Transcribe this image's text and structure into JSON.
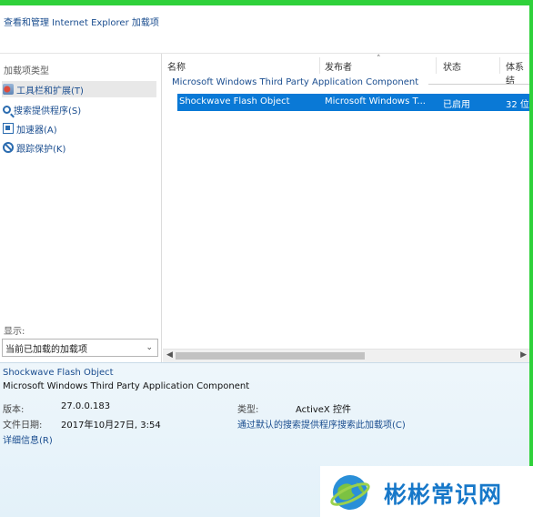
{
  "header": {
    "title": "查看和管理 Internet Explorer 加载项"
  },
  "left_panel": {
    "title": "加载项类型",
    "categories": [
      {
        "label": "工具栏和扩展(T)",
        "icon": "toolbar-extension-icon",
        "selected": true
      },
      {
        "label": "搜索提供程序(S)",
        "icon": "search-icon",
        "selected": false
      },
      {
        "label": "加速器(A)",
        "icon": "accelerator-icon",
        "selected": false
      },
      {
        "label": "跟踪保护(K)",
        "icon": "tracking-protection-icon",
        "selected": false
      }
    ],
    "show_label": "显示:",
    "show_select_value": "当前已加载的加载项"
  },
  "list": {
    "columns": [
      "名称",
      "发布者",
      "状态",
      "体系结"
    ],
    "group": "Microsoft Windows Third Party Application Component",
    "rows": [
      {
        "name": "Shockwave Flash Object",
        "publisher": "Microsoft Windows T...",
        "status": "已启用",
        "arch": "32 位"
      }
    ]
  },
  "details": {
    "name": "Shockwave Flash Object",
    "publisher": "Microsoft Windows Third Party Application Component",
    "version_label": "版本:",
    "version_value": "27.0.0.183",
    "date_label": "文件日期:",
    "date_value": "2017年10月27日, 3:54",
    "more_info_link": "详细信息(R)",
    "type_label": "类型:",
    "type_value": "ActiveX 控件",
    "search_link": "通过默认的搜索提供程序搜索此加载项(C)"
  },
  "watermark": {
    "text": "彬彬常识网"
  },
  "colors": {
    "accent": "#0a79d6",
    "border_green": "#2fd13a",
    "link_blue": "#1a4d8f",
    "details_bg": "#e3f1f9"
  }
}
